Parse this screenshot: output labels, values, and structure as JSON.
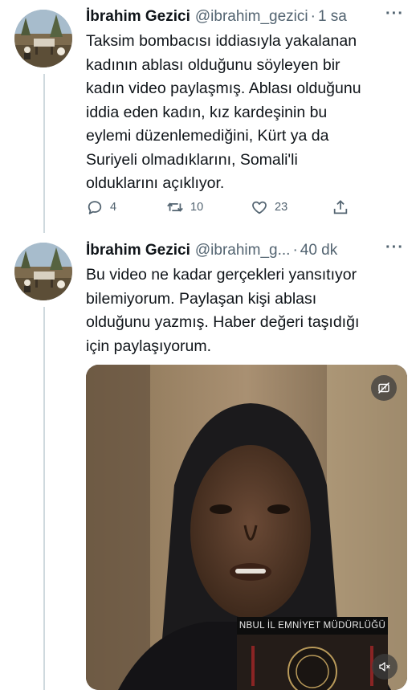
{
  "tweets": [
    {
      "author_name": "İbrahim Gezici",
      "handle": "@ibrahim_gezici",
      "separator": "·",
      "time": "1 sa",
      "more_glyph": "···",
      "text_lines": [
        "Taksim bombacısı iddiasıyla yakalanan",
        "kadının ablası olduğunu söyleyen bir",
        "kadın video paylaşmış. Ablası olduğunu",
        "iddia eden kadın, kız kardeşinin bu",
        "eylemi düzenlemediğini, Kürt ya da",
        "Suriyeli olmadıklarını, Somali'li",
        "olduklarını açıklıyor."
      ],
      "actions": {
        "reply": {
          "icon": "reply-icon",
          "count": "4"
        },
        "retweet": {
          "icon": "retweet-icon",
          "count": "10"
        },
        "like": {
          "icon": "heart-icon",
          "count": "23"
        },
        "share": {
          "icon": "share-icon"
        }
      }
    },
    {
      "author_name": "İbrahim Gezici",
      "handle": "@ibrahim_g...",
      "separator": "·",
      "time": "40 dk",
      "more_glyph": "···",
      "text_lines": [
        "Bu video ne kadar gerçekleri yansıtıyor",
        "bilemiyorum. Paylaşan kişi ablası",
        "olduğunu yazmış. Haber değeri taşıdığı",
        "için paylaşıyorum."
      ]
    }
  ],
  "video": {
    "overlay_banner": "NBUL İL EMNİYET MÜDÜRLÜĞÜ",
    "top_icon": "captions-off-icon",
    "bottom_icon": "mute-icon"
  },
  "colors": {
    "text": "#0f1419",
    "secondary": "#536471",
    "thread_line": "#cfd9de"
  }
}
